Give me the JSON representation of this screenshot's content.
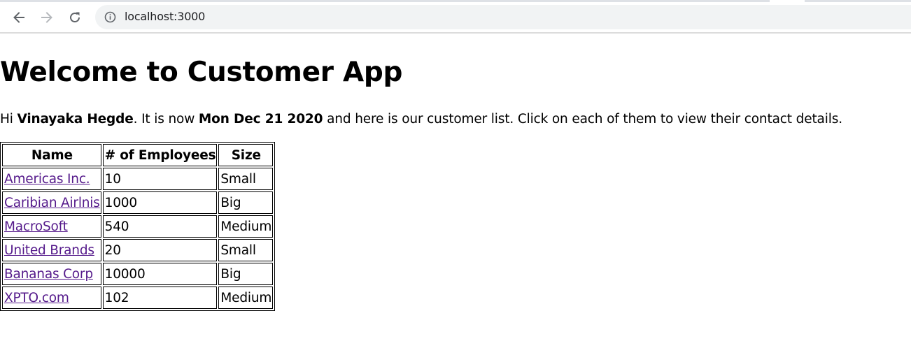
{
  "browser": {
    "url": "localhost:3000"
  },
  "page": {
    "title": "Welcome to Customer App",
    "greeting": {
      "prefix": "Hi ",
      "user_name": "Vinayaka Hegde",
      "middle": ". It is now ",
      "date": "Mon Dec 21 2020",
      "suffix": " and here is our customer list. Click on each of them to view their contact details."
    },
    "table": {
      "headers": {
        "name": "Name",
        "employees": "# of Employees",
        "size": "Size"
      },
      "rows": [
        {
          "name": "Americas Inc.",
          "employees": "10",
          "size": "Small"
        },
        {
          "name": "Caribian Airlnis",
          "employees": "1000",
          "size": "Big"
        },
        {
          "name": "MacroSoft",
          "employees": "540",
          "size": "Medium"
        },
        {
          "name": "United Brands",
          "employees": "20",
          "size": "Small"
        },
        {
          "name": "Bananas Corp",
          "employees": "10000",
          "size": "Big"
        },
        {
          "name": "XPTO.com",
          "employees": "102",
          "size": "Medium"
        }
      ]
    }
  },
  "icons": {
    "back": "back-arrow-icon",
    "forward": "forward-arrow-icon",
    "reload": "reload-icon",
    "info": "info-icon"
  },
  "colors": {
    "visited_link": "#551a8b",
    "omnibox_bg": "#f1f3f4"
  }
}
